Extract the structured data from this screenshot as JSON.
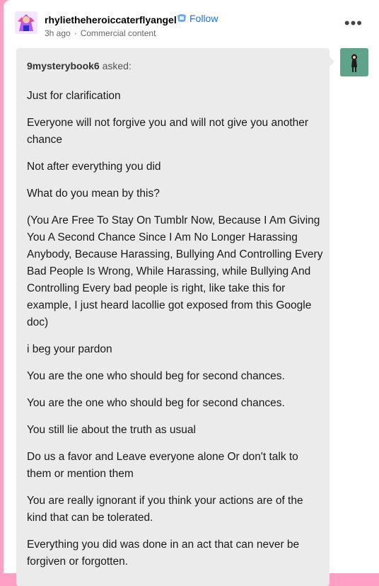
{
  "post": {
    "blog_name": "rhylietheheroiccaterflyangel",
    "follow_label": "Follow",
    "time": "3h ago",
    "separator": "·",
    "label": "Commercial content",
    "more_label": "•••"
  },
  "ask": {
    "asker": "9mysterybook6",
    "asked_label": "asked:",
    "paragraphs": [
      "Just for clarification",
      "Everyone will not forgive you and will not give you another chance",
      "Not after everything you did",
      "What do you mean by this?",
      "(You Are Free To Stay On Tumblr Now, Because I Am Giving You A Second Chance Since I Am No Longer Harassing Anybody, Because Harassing, Bullying And Controlling Every Bad People Is Wrong, While Harassing, while Bullying And Controlling Every bad people is right, like take this for example, I just heard lacollie got exposed from this Google doc)",
      "i beg your pardon",
      "You are the one who should beg for second chances.",
      "You are the one who should beg for second chances.",
      "You still lie about the truth as usual",
      "Do us a favor and Leave everyone alone Or don't talk to them or mention them",
      "You are really ignorant if you think your actions are of the kind that can be tolerated.",
      "Everything you did was done in an act that can never be forgiven or forgotten."
    ]
  },
  "icons": {
    "avatar": "avatar-icon",
    "follow": "follow-icon",
    "more": "more-icon",
    "asker_avatar": "asker-avatar-icon"
  },
  "colors": {
    "background": "#ff9fc6",
    "follow": "#1a73e8",
    "ask_box": "#ebebeb",
    "asker_avatar_bg": "#5fa48a"
  }
}
